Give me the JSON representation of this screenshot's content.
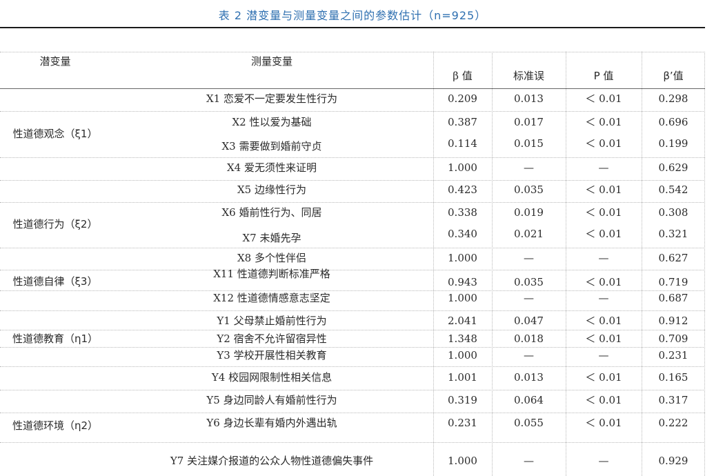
{
  "title": "表 2 潜变量与测量变量之间的参数估计（n=925）",
  "headers": {
    "latent": "潜变量",
    "measured": "测量变量",
    "beta": "β 值",
    "se": "标准误",
    "p": "P 值",
    "beta_std": "β’值"
  },
  "latent_groups": [
    "性道德观念（ξ1）",
    "性道德行为（ξ2）",
    "性道德自律（ξ3）",
    "性道德教育（η1）",
    "性道德环境（η2）"
  ],
  "rows": [
    {
      "measured": "X1 恋爱不一定要发生性行为",
      "beta": "0.209",
      "se": "0.013",
      "p": "＜ 0.01",
      "beta_std": "0.298"
    },
    {
      "measured": "X2 性以爱为基础",
      "beta": "0.387",
      "se": "0.017",
      "p": "＜ 0.01",
      "beta_std": "0.696"
    },
    {
      "measured": "X3 需要做到婚前守贞",
      "beta": "0.114",
      "se": "0.015",
      "p": "＜ 0.01",
      "beta_std": "0.199"
    },
    {
      "measured": "X4 爱无须性来证明",
      "beta": "1.000",
      "se": "—",
      "p": "—",
      "beta_std": "0.629"
    },
    {
      "measured": "X5 边缘性行为",
      "beta": "0.423",
      "se": "0.035",
      "p": "＜ 0.01",
      "beta_std": "0.542"
    },
    {
      "measured": "X6 婚前性行为、同居",
      "beta": "0.338",
      "se": "0.019",
      "p": "＜ 0.01",
      "beta_std": "0.308"
    },
    {
      "measured": "X7 未婚先孕",
      "beta": "0.340",
      "se": "0.021",
      "p": "＜ 0.01",
      "beta_std": "0.321"
    },
    {
      "measured": "X8 多个性伴侣",
      "beta": "1.000",
      "se": "—",
      "p": "—",
      "beta_std": "0.627"
    },
    {
      "measured": "X11 性道德判断标准严格",
      "beta": "0.943",
      "se": "0.035",
      "p": "＜ 0.01",
      "beta_std": "0.719"
    },
    {
      "measured": "X12 性道德情感意志坚定",
      "beta": "1.000",
      "se": "—",
      "p": "—",
      "beta_std": "0.687"
    },
    {
      "measured": "Y1 父母禁止婚前性行为",
      "beta": "2.041",
      "se": "0.047",
      "p": "＜ 0.01",
      "beta_std": "0.912"
    },
    {
      "measured": "Y2 宿舍不允许留宿异性",
      "beta": "1.348",
      "se": "0.018",
      "p": "＜ 0.01",
      "beta_std": "0.709"
    },
    {
      "measured": "Y3 学校开展性相关教育",
      "beta": "1.000",
      "se": "—",
      "p": "—",
      "beta_std": "0.231"
    },
    {
      "measured": "Y4 校园网限制性相关信息",
      "beta": "1.001",
      "se": "0.013",
      "p": "＜ 0.01",
      "beta_std": "0.165"
    },
    {
      "measured": "Y5 身边同龄人有婚前性行为",
      "beta": "0.319",
      "se": "0.064",
      "p": "＜ 0.01",
      "beta_std": "0.317"
    },
    {
      "measured": "Y6 身边长辈有婚内外遇出轨",
      "beta": "0.231",
      "se": "0.055",
      "p": "＜ 0.01",
      "beta_std": "0.222"
    },
    {
      "measured": "Y7 关注媒介报道的公众人物性道德偏失事件",
      "beta": "1.000",
      "se": "—",
      "p": "—",
      "beta_std": "0.929"
    }
  ]
}
